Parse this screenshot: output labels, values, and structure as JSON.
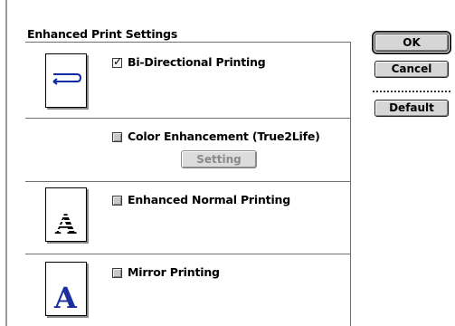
{
  "dialog": {
    "group_title": "Enhanced Print Settings",
    "ok_label": "OK",
    "cancel_label": "Cancel",
    "default_label": "Default"
  },
  "options": [
    {
      "label": "Bi-Directional Printing",
      "checked": true,
      "icon": "bidirectional-arrow-icon"
    },
    {
      "label": "Color Enhancement (True2Life)",
      "checked": false,
      "setting_label": "Setting",
      "setting_enabled": false
    },
    {
      "label": "Enhanced Normal Printing",
      "checked": false,
      "icon": "letter-a-striped-icon",
      "icon_glyph": "A"
    },
    {
      "label": "Mirror Printing",
      "checked": false,
      "icon": "letter-a-blue-icon",
      "icon_glyph": "A",
      "icon_color": "#1c2f9e"
    }
  ]
}
